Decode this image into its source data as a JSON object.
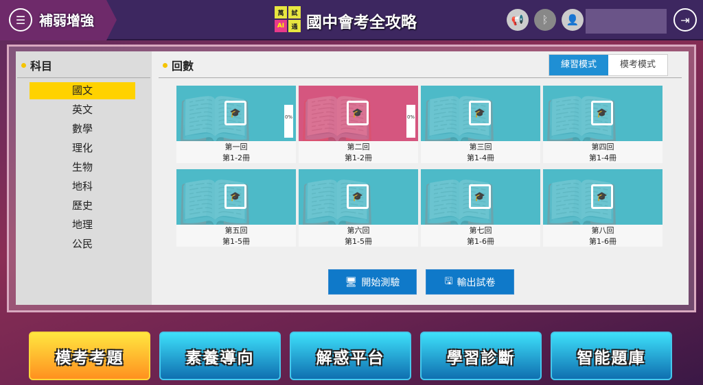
{
  "header": {
    "left_title": "補弱增強",
    "app_title": "國中會考全攻略",
    "logo_chars": [
      "萬",
      "試",
      "AI",
      "通"
    ],
    "icons": [
      "megaphone-icon",
      "bluetooth-icon",
      "user-icon",
      "logout-icon"
    ]
  },
  "subjects": {
    "heading": "科目",
    "items": [
      "國文",
      "英文",
      "數學",
      "理化",
      "生物",
      "地科",
      "歷史",
      "地理",
      "公民"
    ],
    "selected": "國文"
  },
  "rounds": {
    "heading": "回數",
    "modes": [
      "練習模式",
      "模考模式"
    ],
    "active_mode": "練習模式",
    "cards": [
      {
        "title": "第一回",
        "range": "第1-2冊",
        "progress": "0%",
        "color": "#4dbac8"
      },
      {
        "title": "第二回",
        "range": "第1-2冊",
        "progress": "0%",
        "color": "#d5567f"
      },
      {
        "title": "第三回",
        "range": "第1-4冊",
        "color": "#4dbac8"
      },
      {
        "title": "第四回",
        "range": "第1-4冊",
        "color": "#4dbac8"
      },
      {
        "title": "第五回",
        "range": "第1-5冊",
        "color": "#4dbac8"
      },
      {
        "title": "第六回",
        "range": "第1-5冊",
        "color": "#4dbac8"
      },
      {
        "title": "第七回",
        "range": "第1-6冊",
        "color": "#4dbac8"
      },
      {
        "title": "第八回",
        "range": "第1-6冊",
        "color": "#4dbac8"
      }
    ]
  },
  "actions": {
    "start": "開始測驗",
    "export": "輸出試卷"
  },
  "bottom_nav": {
    "items": [
      "模考考題",
      "素養導向",
      "解惑平台",
      "學習診斷",
      "智能題庫"
    ],
    "selected": "模考考題"
  }
}
